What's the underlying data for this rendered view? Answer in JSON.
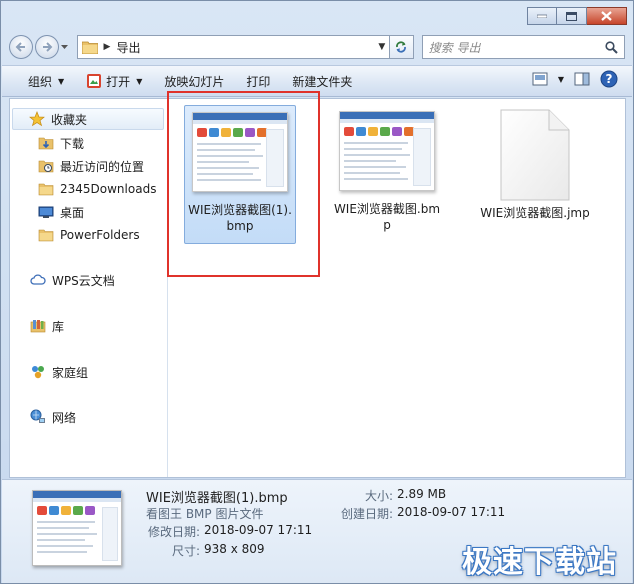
{
  "address": {
    "crumb": "导出"
  },
  "search": {
    "placeholder": "搜索 导出"
  },
  "toolbar": {
    "organize": "组织",
    "open": "打开",
    "slideshow": "放映幻灯片",
    "print": "打印",
    "new_folder": "新建文件夹"
  },
  "sidebar": {
    "favorites": "收藏夹",
    "items": [
      {
        "label": "下载"
      },
      {
        "label": "最近访问的位置"
      },
      {
        "label": "2345Downloads"
      },
      {
        "label": "桌面"
      },
      {
        "label": "PowerFolders"
      }
    ],
    "wps": "WPS云文档",
    "library": "库",
    "homegroup": "家庭组",
    "network": "网络"
  },
  "files": [
    {
      "name": "WIE浏览器截图(1).bmp",
      "selected": true,
      "kind": "image"
    },
    {
      "name": "WIE浏览器截图.bmp",
      "selected": false,
      "kind": "image"
    },
    {
      "name": "WIE浏览器截图.jmp",
      "selected": false,
      "kind": "document"
    }
  ],
  "details": {
    "filename": "WIE浏览器截图(1).bmp",
    "type": "看图王 BMP 图片文件",
    "modified_label": "修改日期:",
    "modified_value": "2018-09-07 17:11",
    "dimensions_label": "尺寸:",
    "dimensions_value": "938 x 809",
    "size_label": "大小:",
    "size_value": "2.89 MB",
    "created_label": "创建日期:",
    "created_value": "2018-09-07 17:11"
  },
  "watermark": "极速下载站",
  "colors": {
    "highlight": "#e0322b",
    "selection": "#c3dcf7",
    "accent": "#3a6fb7"
  }
}
